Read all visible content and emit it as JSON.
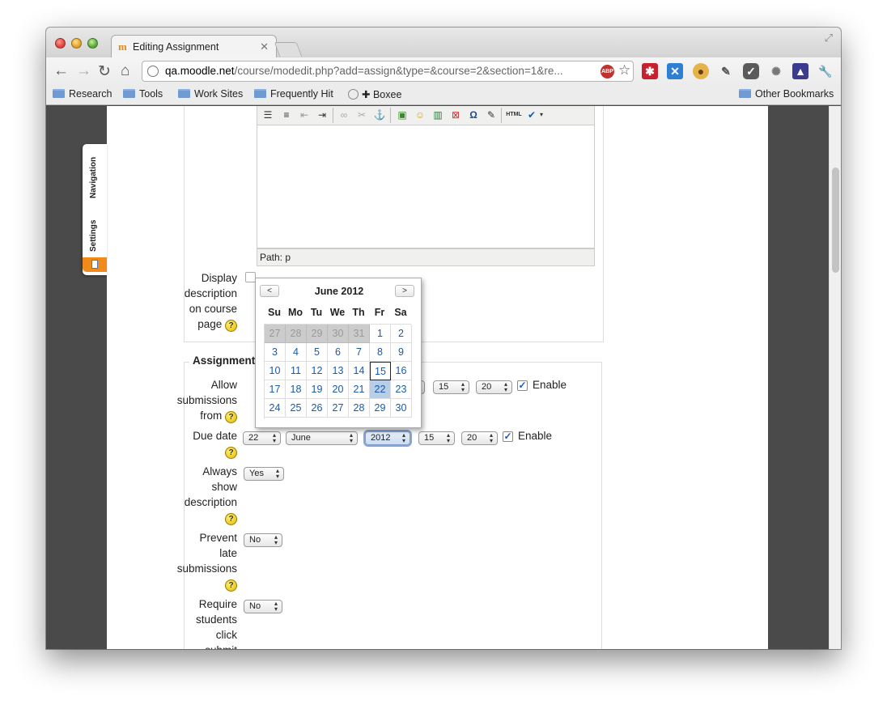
{
  "browser": {
    "tab_title": "Editing Assignment",
    "url_host": "qa.moodle.net",
    "url_path": "/course/modedit.php?add=assign&type=&course=2&section=1&re...",
    "abp_label": "ABP"
  },
  "bookmarks": {
    "items": [
      "Research",
      "Tools",
      "Work Sites",
      "Frequently Hit",
      "✚ Boxee"
    ],
    "other": "Other Bookmarks"
  },
  "dock": {
    "navigation": "Navigation",
    "settings": "Settings"
  },
  "editor": {
    "path_label": "Path: p",
    "html_label": "HTML"
  },
  "form": {
    "display_description_label": [
      "Display",
      "description",
      "on course",
      "page"
    ],
    "assignment_settings_legend": "Assignment s",
    "allow_submissions_label": [
      "Allow",
      "submissions",
      "from"
    ],
    "due_date_label": "Due date",
    "always_show_label": [
      "Always",
      "show",
      "description"
    ],
    "prevent_late_label": [
      "Prevent",
      "late",
      "submissions"
    ],
    "require_click_label": [
      "Require",
      "students",
      "click",
      "submit"
    ],
    "enable_label": "Enable",
    "allow_hour": "15",
    "allow_minute": "20",
    "due_day": "22",
    "due_month": "June",
    "due_year": "2012",
    "due_hour": "15",
    "due_minute": "20",
    "always_show_value": "Yes",
    "prevent_late_value": "No",
    "require_click_value": "No",
    "help_glyph": "?"
  },
  "calendar": {
    "title": "June 2012",
    "prev_label": "<",
    "next_label": ">",
    "weekdays": [
      "Su",
      "Mo",
      "Tu",
      "We",
      "Th",
      "Fr",
      "Sa"
    ],
    "weeks": [
      [
        "27",
        "28",
        "29",
        "30",
        "31",
        "1",
        "2"
      ],
      [
        "3",
        "4",
        "5",
        "6",
        "7",
        "8",
        "9"
      ],
      [
        "10",
        "11",
        "12",
        "13",
        "14",
        "15",
        "16"
      ],
      [
        "17",
        "18",
        "19",
        "20",
        "21",
        "22",
        "23"
      ],
      [
        "24",
        "25",
        "26",
        "27",
        "28",
        "29",
        "30"
      ]
    ],
    "today": "15",
    "selected": "22"
  },
  "colors": {
    "moodle_orange": "#f08a1b",
    "link_blue": "#1a5aa8",
    "selected_day": "#b7cde8"
  }
}
